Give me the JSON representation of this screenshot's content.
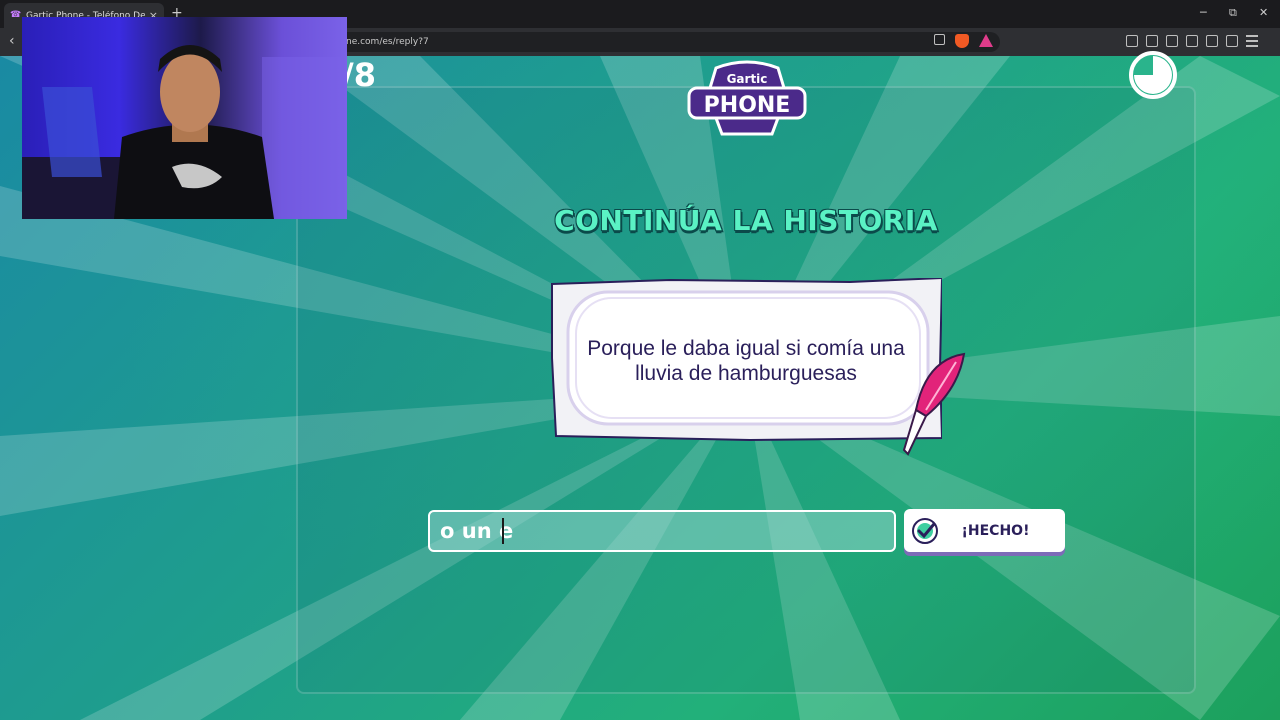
{
  "browser": {
    "tab_title": "Gartic Phone - Teléfono Descon",
    "tab_favicon": "phone-icon",
    "new_tab": "+",
    "url": "ne.com/es/reply?7",
    "min": "─",
    "max": "⧉",
    "close": "✕"
  },
  "game": {
    "round_counter": "/8",
    "logo_top": "Gartic",
    "logo_bottom": "PHONE",
    "heading": "CONTINÚA LA HISTORIA",
    "prompt_text": "Porque le daba igual si comía una lluvia de hamburguesas",
    "answer_value": "o un e",
    "done_label": "¡HECHO!"
  },
  "colors": {
    "accent": "#5af2c4",
    "text_dark": "#2a1f5a",
    "bg_teal": "#1fa08a",
    "logo_purple": "#4b2a8a"
  }
}
